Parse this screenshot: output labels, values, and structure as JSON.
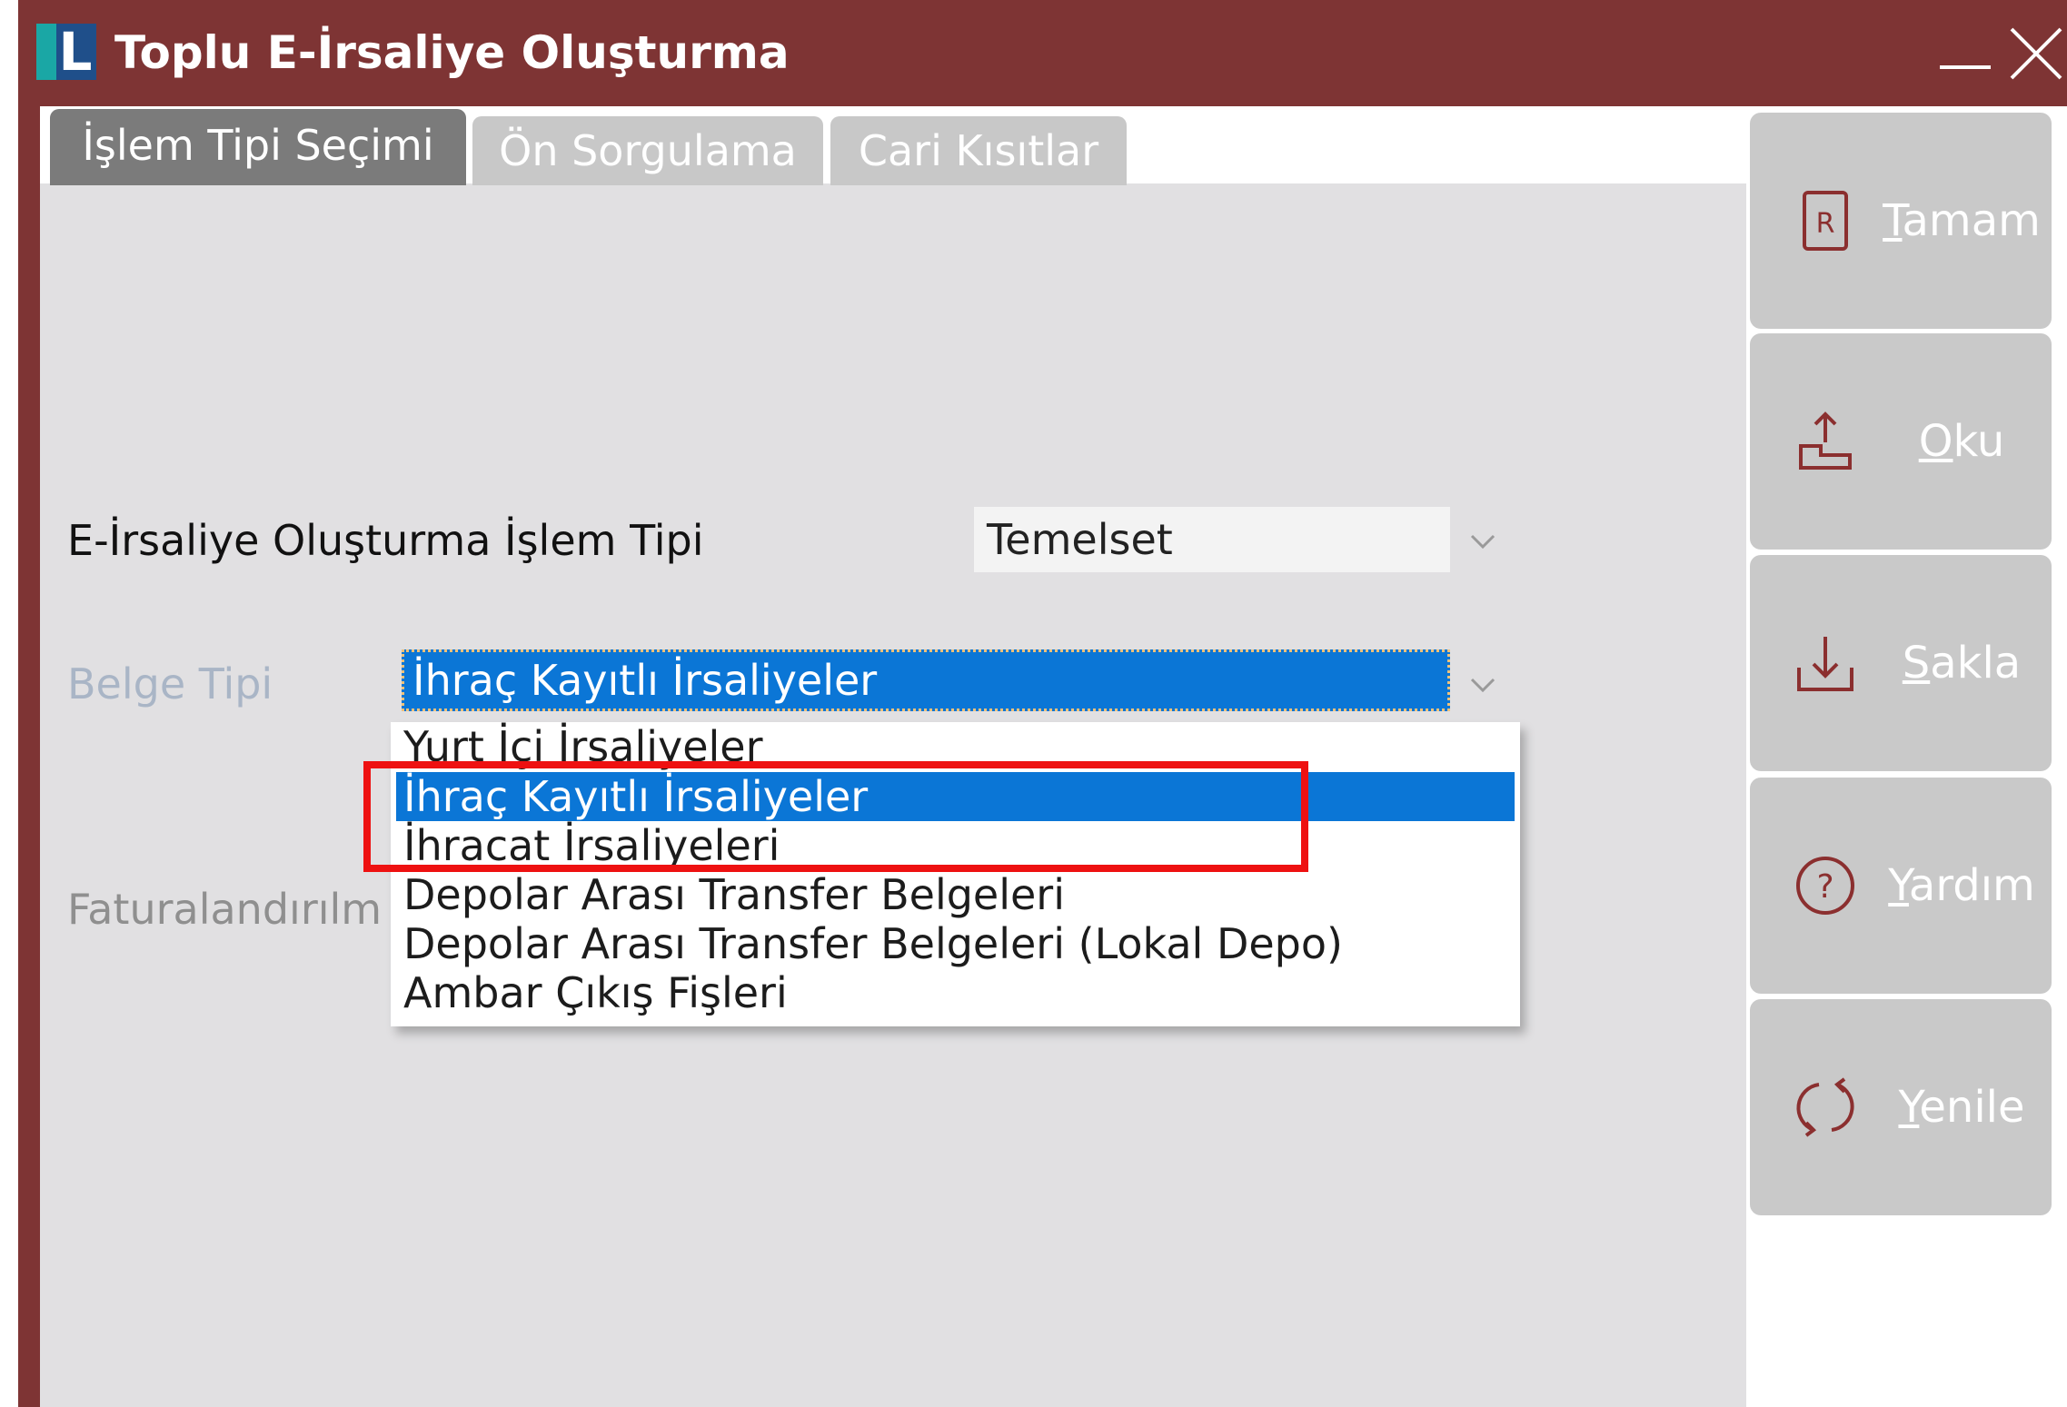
{
  "window": {
    "title": "Toplu E-İrsaliye Oluşturma",
    "logo_letter": "L",
    "minimize_icon": "minimize-icon",
    "close_icon": "close-icon"
  },
  "tabs": [
    {
      "label": "İşlem Tipi Seçimi",
      "active": true
    },
    {
      "label": "Ön Sorgulama",
      "active": false
    },
    {
      "label": "Cari Kısıtlar",
      "active": false
    }
  ],
  "form": {
    "islem_tipi_label": "E-İrsaliye Oluşturma İşlem Tipi",
    "islem_tipi_value": "Temelset",
    "belge_tipi_label": "Belge Tipi",
    "belge_tipi_value": "İhraç Kayıtlı İrsaliyeler",
    "faturalandirilma_label": "Faturalandırılm"
  },
  "dropdown": {
    "options": [
      "Yurt İçi İrsaliyeler",
      "İhraç Kayıtlı İrsaliyeler",
      "İhracat İrsaliyeleri",
      "Depolar Arası Transfer Belgeleri",
      "Depolar Arası Transfer Belgeleri (Lokal Depo)",
      "Ambar Çıkış Fişleri"
    ],
    "selected_index": 1
  },
  "buttons": [
    {
      "underline": "T",
      "rest": "amam",
      "icon": "report-icon"
    },
    {
      "underline": "O",
      "rest": "ku",
      "icon": "upload-icon"
    },
    {
      "underline": "S",
      "rest": "akla",
      "icon": "download-icon"
    },
    {
      "underline": "Y",
      "rest": "ardım",
      "icon": "help-icon"
    },
    {
      "underline": "Y",
      "rest": "enile",
      "icon": "refresh-icon"
    }
  ],
  "colors": {
    "titlebar": "#7e3434",
    "selection": "#0b76d6",
    "highlight_box": "#ee1111",
    "icon_accent": "#8b2f2f"
  }
}
